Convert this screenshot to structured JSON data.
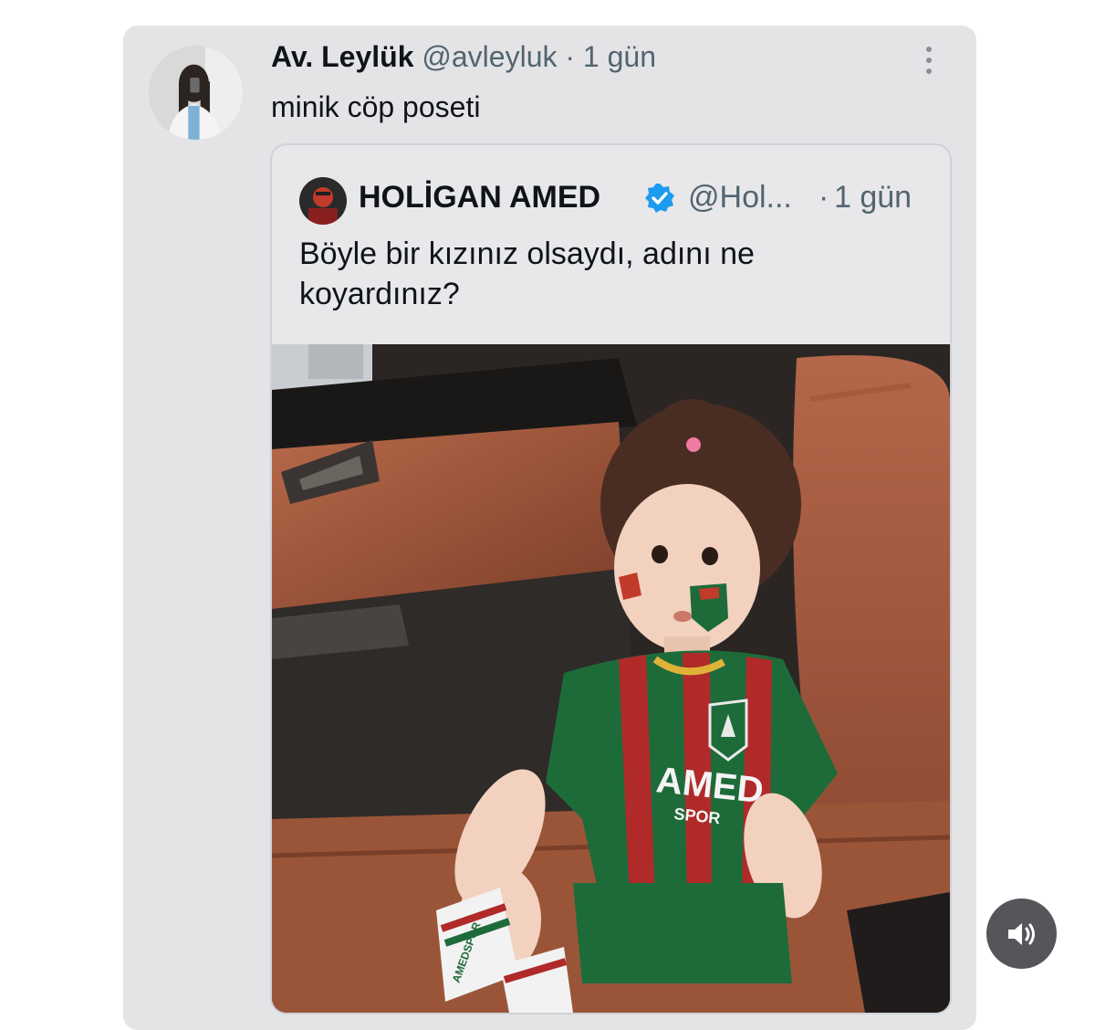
{
  "reply": {
    "author_name": "Av. Leylük",
    "author_handle": "@avleyluk",
    "separator": "·",
    "time": "1 gün",
    "text": "minik cöp poseti"
  },
  "quoted": {
    "author_name": "HOLİGAN AMED",
    "verified": true,
    "author_handle": "@Hol...",
    "separator": "·",
    "time": "1 gün",
    "text": "Böyle bir kızınız olsaydı, adını ne koyardınız?",
    "image": {
      "shirt_text": "AMED",
      "shirt_subtext": "SPOR",
      "sock_text": "AMEDSPOR"
    }
  },
  "icons": {
    "more": "more-vertical-icon",
    "verified": "verified-badge-icon",
    "sound": "sound-icon"
  },
  "colors": {
    "card_bg": "#e4e4e6",
    "verified_blue": "#1d9bf0",
    "muted_text": "#536471",
    "jersey_green": "#1e6b3a",
    "jersey_red": "#b02a2a"
  }
}
